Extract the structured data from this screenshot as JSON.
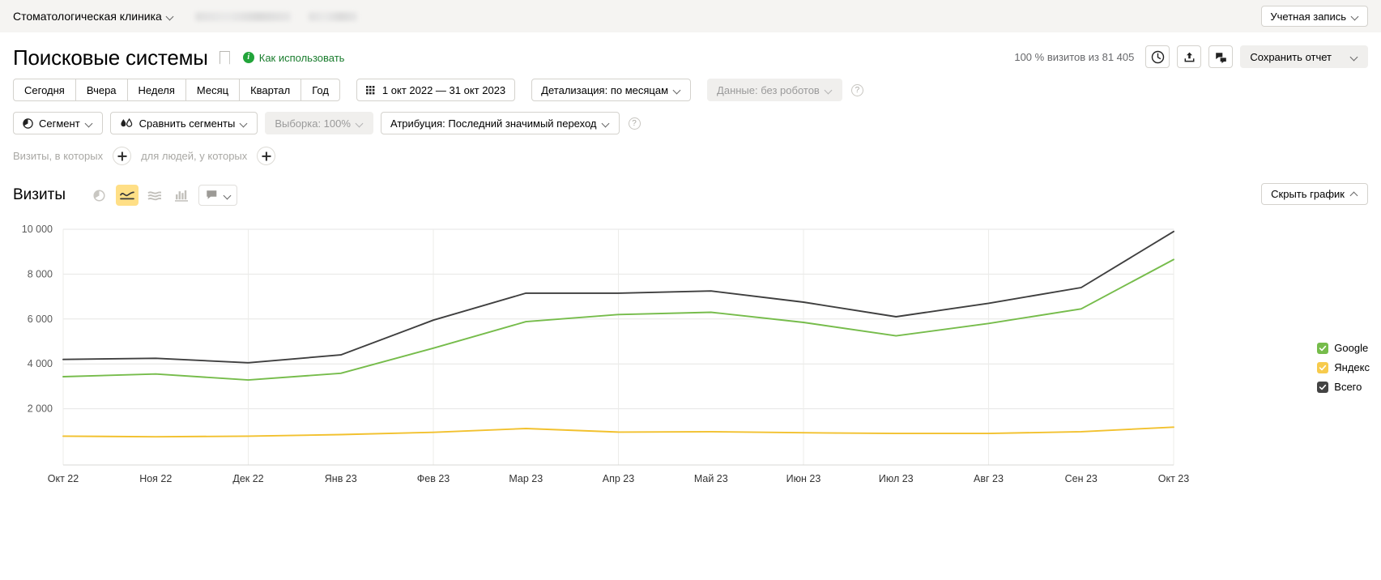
{
  "topbar": {
    "counter_name": "Стоматологическая клиника",
    "account_label": "Учетная запись"
  },
  "header": {
    "title": "Поисковые системы",
    "howto_label": "Как использовать",
    "info_glyph": "i",
    "visits_share": "100 % визитов из 81 405",
    "save_report_label": "Сохранить отчет",
    "icons": [
      "clock-icon",
      "share-icon",
      "comments-icon"
    ]
  },
  "period": {
    "buttons": [
      "Сегодня",
      "Вчера",
      "Неделя",
      "Месяц",
      "Квартал",
      "Год"
    ],
    "date_range": "1 окт 2022 — 31 окт 2023",
    "detail": "Детализация: по месяцам",
    "data_robots": "Данные: без роботов",
    "help_glyph": "?"
  },
  "segment": {
    "segment_label": "Сегмент",
    "compare_label": "Сравнить сегменты",
    "sampling_label": "Выборка: 100%",
    "attribution_label": "Атрибуция: Последний значимый переход",
    "help_glyph": "?"
  },
  "filters": {
    "visits_label": "Визиты, в которых",
    "people_label": "для людей, у которых",
    "add_glyph": "+"
  },
  "chart_header": {
    "metric": "Визиты",
    "chart_types": [
      "pie-chart-icon",
      "line-chart-icon",
      "area-chart-icon",
      "bar-chart-icon"
    ],
    "active_type_index": 1,
    "annotation_icon": "comment-bubble-icon",
    "hide_chart_label": "Скрыть график"
  },
  "chart_data": {
    "type": "line",
    "title": "Визиты",
    "xlabel": "",
    "ylabel": "",
    "grid": true,
    "legend_position": "right",
    "ylim": [
      0,
      10000
    ],
    "yticks": [
      2000,
      4000,
      6000,
      8000,
      10000
    ],
    "ytick_labels": [
      "2 000",
      "4 000",
      "6 000",
      "8 000",
      "10 000"
    ],
    "categories": [
      "Окт 22",
      "Ноя 22",
      "Дек 22",
      "Янв 23",
      "Фев 23",
      "Мар 23",
      "Апр 23",
      "Май 23",
      "Июн 23",
      "Июл 23",
      "Авг 23",
      "Сен 23",
      "Окт 23"
    ],
    "series": [
      {
        "name": "Всего",
        "color": "#3f3f3f",
        "checked": true,
        "values": [
          4200,
          4250,
          4050,
          4400,
          5950,
          7150,
          7150,
          7250,
          6750,
          6100,
          6700,
          7400,
          9900
        ]
      },
      {
        "name": "Google",
        "color": "#76bc4b",
        "checked": true,
        "values": [
          3430,
          3550,
          3280,
          3580,
          4700,
          5880,
          6200,
          6300,
          5850,
          5250,
          5800,
          6450,
          8650
        ]
      },
      {
        "name": "Яндекс",
        "color": "#f2c12e",
        "checked": true,
        "values": [
          780,
          750,
          780,
          850,
          950,
          1120,
          960,
          980,
          930,
          900,
          900,
          980,
          1180
        ]
      }
    ]
  },
  "legend": [
    {
      "label": "Google",
      "color": "#76bc4b"
    },
    {
      "label": "Яндекс",
      "color": "#f7cb4d"
    },
    {
      "label": "Всего",
      "color": "#444444"
    }
  ]
}
